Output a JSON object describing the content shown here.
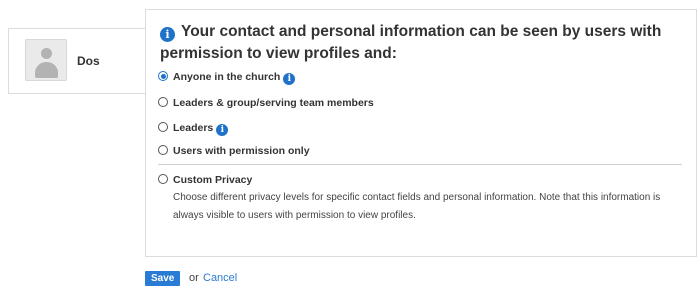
{
  "profile": {
    "name": "Dos"
  },
  "privacy": {
    "title": "Your contact and personal information can be seen by users with permission to view profiles and:",
    "options": [
      {
        "label": "Anyone in the church",
        "selected": true,
        "info_icon": true
      },
      {
        "label": "Leaders & group/serving team members",
        "selected": false,
        "info_icon": false
      },
      {
        "label": "Leaders",
        "selected": false,
        "info_icon": true
      },
      {
        "label": "Users with permission only",
        "selected": false,
        "info_icon": false
      },
      {
        "label": "Custom Privacy",
        "selected": false,
        "info_icon": false
      }
    ],
    "custom_description": "Choose different privacy levels for specific contact fields and personal information. Note that this information is always visible to users with permission to view profiles."
  },
  "actions": {
    "save_label": "Save",
    "or_text": "or",
    "cancel_label": "Cancel"
  },
  "colors": {
    "accent": "#1f72c9",
    "save_button": "#2a7bd3",
    "border": "#dcdcdc"
  },
  "icons": {
    "info": "info-icon",
    "avatar": "user-silhouette-icon"
  }
}
